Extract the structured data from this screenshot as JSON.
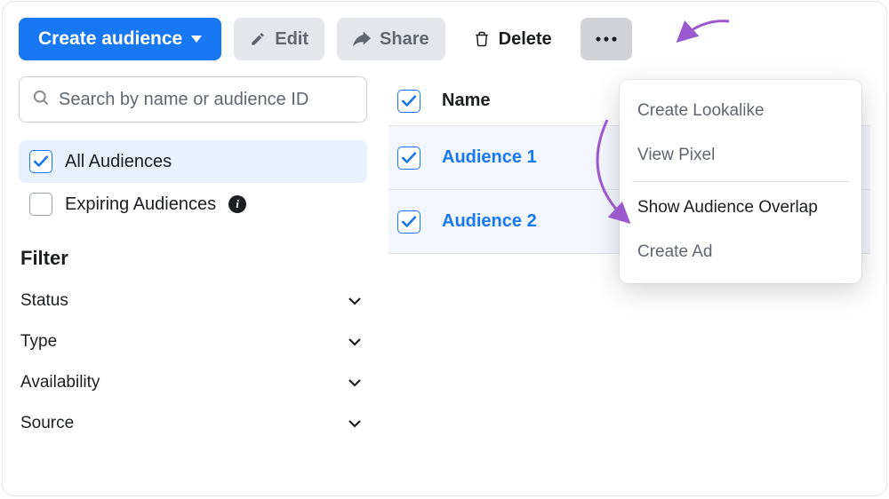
{
  "toolbar": {
    "create_label": "Create audience",
    "edit_label": "Edit",
    "share_label": "Share",
    "delete_label": "Delete"
  },
  "search": {
    "placeholder": "Search by name or audience ID"
  },
  "audience_filters": {
    "all": {
      "label": "All Audiences",
      "checked": true
    },
    "expiring": {
      "label": "Expiring Audiences",
      "checked": false
    }
  },
  "filter": {
    "heading": "Filter",
    "rows": [
      {
        "label": "Status"
      },
      {
        "label": "Type"
      },
      {
        "label": "Availability"
      },
      {
        "label": "Source"
      }
    ]
  },
  "table": {
    "header_checked": true,
    "name_label": "Name",
    "rows": [
      {
        "name": "Audience 1",
        "checked": true
      },
      {
        "name": "Audience 2",
        "checked": true
      }
    ]
  },
  "menu": {
    "create_lookalike": "Create Lookalike",
    "view_pixel": "View Pixel",
    "show_overlap": "Show Audience Overlap",
    "create_ad": "Create Ad"
  }
}
